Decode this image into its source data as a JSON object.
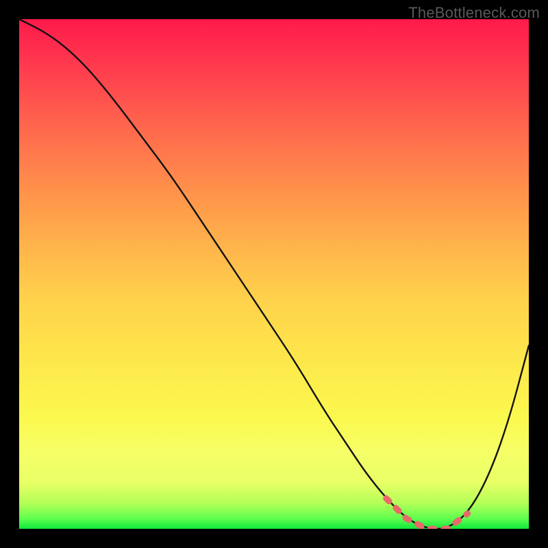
{
  "attribution": "TheBottleneck.com",
  "colors": {
    "frame_bg": "#000000",
    "curve_stroke": "#111111",
    "highlight_stroke": "#e86a6a"
  },
  "chart_data": {
    "type": "line",
    "title": "",
    "xlabel": "",
    "ylabel": "",
    "xlim": [
      0,
      100
    ],
    "ylim": [
      0,
      100
    ],
    "series": [
      {
        "name": "bottleneck-curve",
        "x": [
          0,
          6,
          12,
          18,
          24,
          30,
          36,
          42,
          48,
          54,
          60,
          64,
          68,
          72,
          76,
          80,
          84,
          88,
          92,
          96,
          100
        ],
        "values": [
          100,
          97,
          92,
          85,
          77,
          69,
          60,
          51,
          42,
          33,
          23,
          17,
          11,
          6,
          2,
          0,
          0,
          3,
          10,
          21,
          36
        ]
      }
    ],
    "highlight_range_x": [
      72,
      88
    ],
    "gradient_stops": [
      {
        "pct": 0,
        "color": "#ff1a4b"
      },
      {
        "pct": 10,
        "color": "#ff3d4e"
      },
      {
        "pct": 22,
        "color": "#ff6a4d"
      },
      {
        "pct": 33,
        "color": "#ff8f4b"
      },
      {
        "pct": 44,
        "color": "#ffb24b"
      },
      {
        "pct": 55,
        "color": "#ffd24b"
      },
      {
        "pct": 68,
        "color": "#fde94b"
      },
      {
        "pct": 78,
        "color": "#fbf84e"
      },
      {
        "pct": 85,
        "color": "#f6ff67"
      },
      {
        "pct": 91,
        "color": "#e7ff65"
      },
      {
        "pct": 95,
        "color": "#b3ff57"
      },
      {
        "pct": 98,
        "color": "#5fff4f"
      },
      {
        "pct": 100,
        "color": "#10e83c"
      }
    ]
  }
}
